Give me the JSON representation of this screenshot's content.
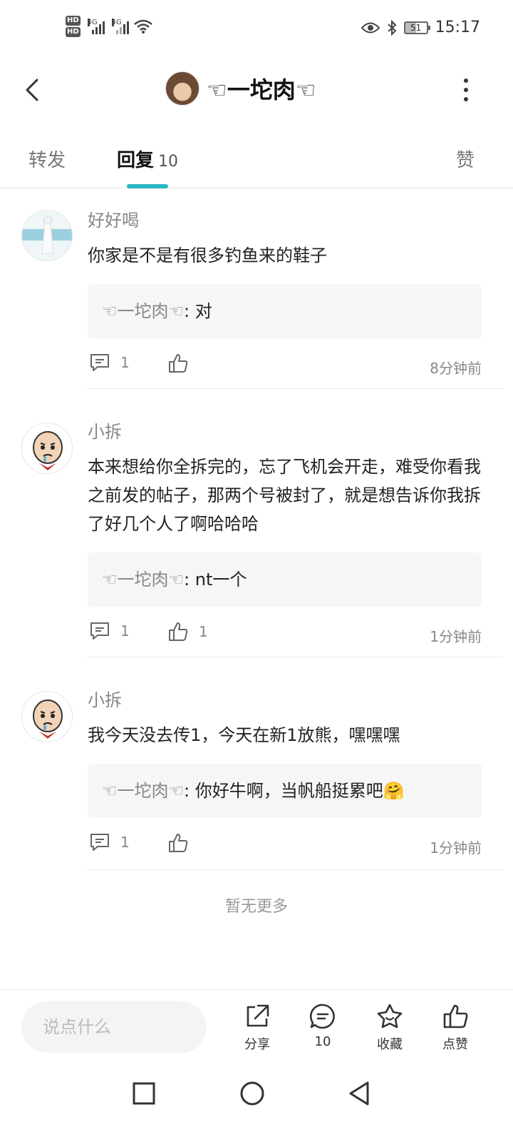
{
  "status_bar": {
    "hd1": "HD",
    "hd2": "HD",
    "net1": "4G",
    "net2": "4G",
    "battery": "51",
    "time": "15:17"
  },
  "header": {
    "title": "☜一坨肉☜"
  },
  "tabs": {
    "forward": "转发",
    "reply": "回复",
    "reply_count": "10",
    "like": "赞"
  },
  "comments": [
    {
      "name": "好好喝",
      "text": "你家是不是有很多钓鱼来的鞋子",
      "quote_name": "☜一坨肉☜",
      "quote_text": ": 对",
      "reply_count": "1",
      "like_count": "",
      "time": "8分钟前"
    },
    {
      "name": "小拆",
      "text": "本来想给你全拆完的，忘了飞机会开走，难受你看我之前发的帖子，那两个号被封了，就是想告诉你我拆了好几个人了啊哈哈哈",
      "quote_name": "☜一坨肉☜",
      "quote_text": ": nt一个",
      "reply_count": "1",
      "like_count": "1",
      "time": "1分钟前"
    },
    {
      "name": "小拆",
      "text": "我今天没去传1，今天在新1放熊，嘿嘿嘿",
      "quote_name": "☜一坨肉☜",
      "quote_text": ": 你好牛啊，当帆船挺累吧🤗",
      "reply_count": "1",
      "like_count": "",
      "time": "1分钟前"
    }
  ],
  "no_more": "暂无更多",
  "bottom_bar": {
    "input_placeholder": "说点什么",
    "share": "分享",
    "comments": "10",
    "favorite": "收藏",
    "like": "点赞"
  },
  "colors": {
    "accent": "#2bb7c6",
    "muted_text": "#888888",
    "quote_bg": "#f6f6f6"
  }
}
